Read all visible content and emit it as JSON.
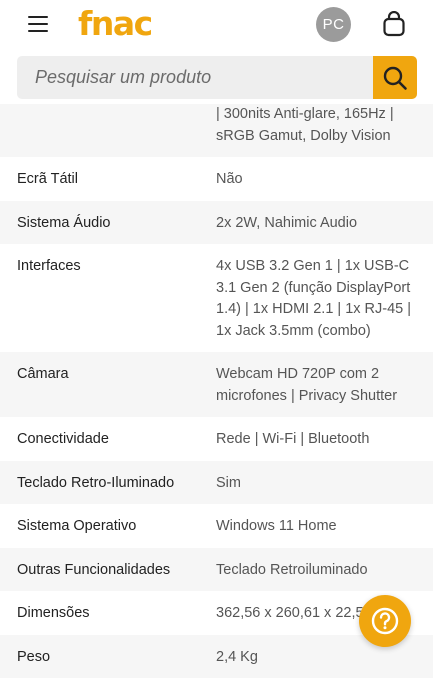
{
  "header": {
    "logo": "fnac",
    "avatar_initials": "PC",
    "search_placeholder": "Pesquisar um produto",
    "menu_icon": "hamburger-menu-icon",
    "cart_icon": "shopping-bag-icon",
    "search_icon": "magnifier-icon"
  },
  "colors": {
    "brand": "#f0a60f",
    "avatar": "#9b9b9b",
    "row_shade": "#f6f6f6"
  },
  "specs": {
    "partial_value": "| 300nits Anti-glare, 165Hz | sRGB Gamut, Dolby Vision",
    "rows": [
      {
        "label": "Ecrã Tátil",
        "value": "Não"
      },
      {
        "label": "Sistema Áudio",
        "value": "2x 2W, Nahimic Audio"
      },
      {
        "label": "Interfaces",
        "value": "4x USB 3.2 Gen 1 | 1x USB-C 3.1 Gen 2 (função DisplayPort 1.4) | 1x HDMI 2.1 | 1x RJ-45 | 1x Jack 3.5mm (combo)"
      },
      {
        "label": "Câmara",
        "value": "Webcam HD 720P com 2 microfones | Privacy Shutter"
      },
      {
        "label": "Conectividade",
        "value": "Rede | Wi-Fi | Bluetooth"
      },
      {
        "label": "Teclado Retro-Iluminado",
        "value": "Sim"
      },
      {
        "label": "Sistema Operativo",
        "value": "Windows 11 Home"
      },
      {
        "label": "Outras Funcionalidades",
        "value": "Teclado Retroiluminado"
      },
      {
        "label": "Dimensões",
        "value": "362,56 x 260,61 x 22,5~ mm"
      },
      {
        "label": "Peso",
        "value": "2,4 Kg"
      }
    ]
  },
  "help_button": {
    "icon": "question-mark-icon"
  }
}
